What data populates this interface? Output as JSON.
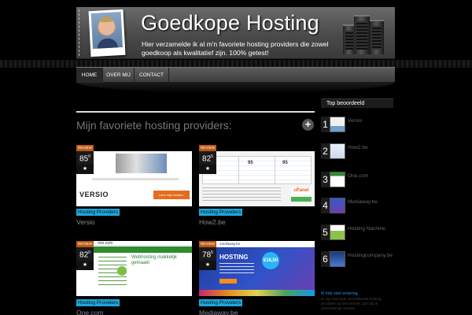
{
  "header": {
    "title": "Goedkope Hosting",
    "subtitle": "Hier verzamelde ik al m'n favoriete hosting providers die zowel goedkoop als kwalitatief zijn. 100% getest!"
  },
  "nav": {
    "items": [
      {
        "label": "HOME",
        "active": true
      },
      {
        "label": "OVER MIJ",
        "active": false
      },
      {
        "label": "CONTACT",
        "active": false
      }
    ]
  },
  "main": {
    "section_title": "Mijn favoriete hosting providers:",
    "plus_label": "+",
    "cards": [
      {
        "review_label": "REVIEW",
        "score": "85",
        "score_decimal": "0",
        "star": "★",
        "category": "Hosting Providers",
        "title": "Versio",
        "shot": {
          "logo": "VERSIO",
          "cta": "Lees mijn review ›"
        }
      },
      {
        "review_label": "REVIEW",
        "score": "82",
        "score_decimal": "5",
        "star": "★",
        "category": "Hosting Providers",
        "title": "How2.be",
        "shot": {
          "price1": "95",
          "price2": "95",
          "badge": "cPanel"
        }
      },
      {
        "review_label": "REVIEW",
        "score": "82",
        "score_decimal": "0",
        "star": "★",
        "category": "Hosting Providers",
        "title": "One.com",
        "shot": {
          "domain": "one.com",
          "headline": "Webhosting makkelijk gemaakt"
        }
      },
      {
        "review_label": "REVIEW",
        "score": "78",
        "score_decimal": "5",
        "star": "★",
        "category": "Hosting Providers",
        "title": "Mediaway.be",
        "shot": {
          "logo": "mediaway.be",
          "headline": "HOSTING",
          "price": "€18,50"
        }
      }
    ]
  },
  "sidebar": {
    "heading": "Top beoordeeld",
    "items": [
      {
        "num": "1",
        "name": "Versio"
      },
      {
        "num": "2",
        "name": "How2.be"
      },
      {
        "num": "3",
        "name": "One.com"
      },
      {
        "num": "4",
        "name": "Mediaway.be"
      },
      {
        "num": "5",
        "name": "Hosting Nachine"
      },
      {
        "num": "6",
        "name": "Hostingcompany.be"
      }
    ],
    "footer_title": "Ik heb veel ervaring",
    "footer_text": "Er zijn heel veel verschillende hosting providers op het internet. Dat zijn al verschillende soorten"
  },
  "colors": {
    "accent_blue": "#1ea7db",
    "review_orange": "#bd5a14",
    "background": "#000000"
  }
}
